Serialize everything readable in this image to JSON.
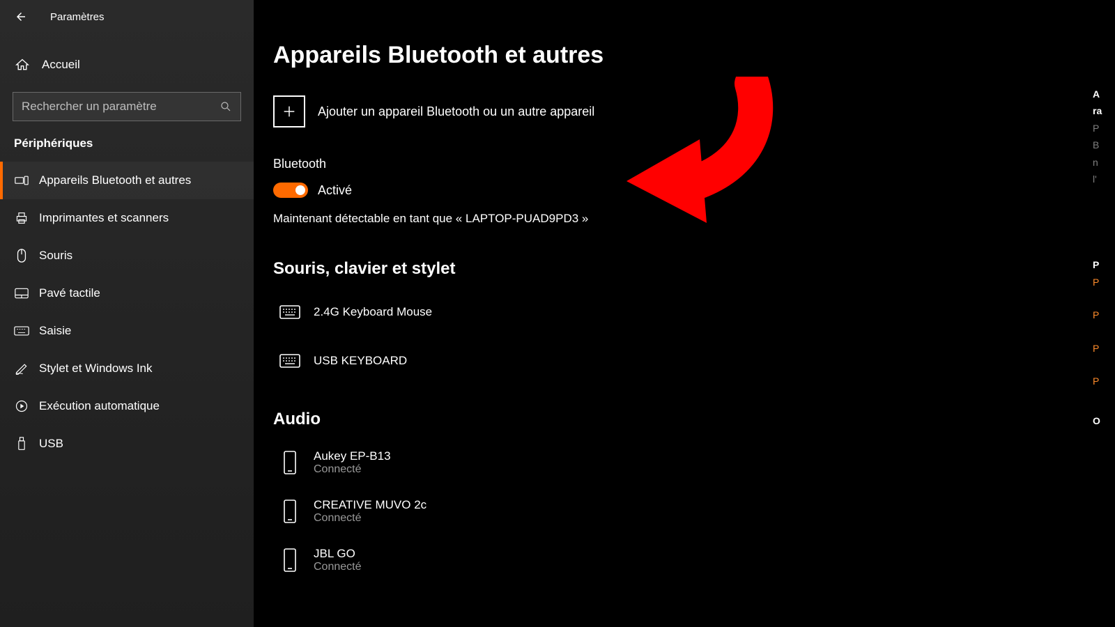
{
  "header": {
    "title": "Paramètres"
  },
  "sidebar": {
    "home": "Accueil",
    "search_placeholder": "Rechercher un paramètre",
    "category": "Périphériques",
    "items": [
      {
        "label": "Appareils Bluetooth et autres",
        "active": true
      },
      {
        "label": "Imprimantes et scanners"
      },
      {
        "label": "Souris"
      },
      {
        "label": "Pavé tactile"
      },
      {
        "label": "Saisie"
      },
      {
        "label": "Stylet et Windows Ink"
      },
      {
        "label": "Exécution automatique"
      },
      {
        "label": "USB"
      }
    ]
  },
  "main": {
    "heading": "Appareils Bluetooth et autres",
    "add_label": "Ajouter un appareil Bluetooth ou un autre appareil",
    "bluetooth_title": "Bluetooth",
    "toggle_state": "Activé",
    "discoverable": "Maintenant détectable en tant que « LAPTOP-PUAD9PD3 »",
    "group_mkb": "Souris, clavier et stylet",
    "mkb_devices": [
      {
        "name": "2.4G Keyboard Mouse"
      },
      {
        "name": "USB KEYBOARD"
      }
    ],
    "group_audio": "Audio",
    "audio_devices": [
      {
        "name": "Aukey EP-B13",
        "status": "Connecté"
      },
      {
        "name": "CREATIVE MUVO 2c",
        "status": "Connecté"
      },
      {
        "name": "JBL GO",
        "status": "Connecté"
      }
    ]
  },
  "right": {
    "r1": "A",
    "r2": "ra",
    "g1": "P",
    "g2": "B",
    "g3": "n",
    "g4": "l'",
    "h2": "P",
    "p1": "P",
    "p2": "P",
    "p3": "P",
    "p4": "P",
    "o1": "O"
  },
  "colors": {
    "accent": "#ff6a00",
    "annotation": "#ff0000"
  }
}
